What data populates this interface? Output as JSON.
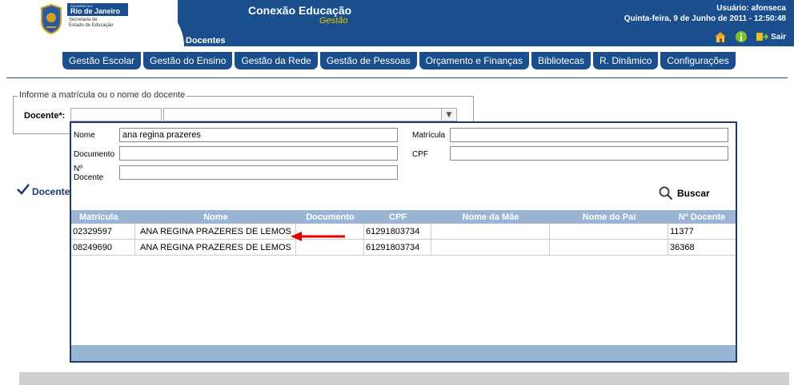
{
  "header": {
    "logo_gov": "GOVERNO DO",
    "logo_rio": "Rio de Janeiro",
    "logo_secretaria": "Secretaria de",
    "logo_estado": "Estado de Educação",
    "app_title": "Conexão Educação",
    "app_subtitle": "Gestão",
    "page_title": "Docentes",
    "user": "Usuário: afonseca",
    "date": "Quinta-feira, 9 de Junho de 2011 - 12:50:48",
    "sair": "Sair"
  },
  "nav": [
    "Gestão Escolar",
    "Gestão do Ensino",
    "Gestão da Rede",
    "Gestão de Pessoas",
    "Orçamento e Finanças",
    "Bibliotecas",
    "R. Dinâmico",
    "Configurações"
  ],
  "search_form": {
    "legend": "Informe a matrícula ou o nome do docente",
    "docente_label": "Docente*:",
    "dropdown_glyph": "▼"
  },
  "tab": {
    "label": "Docentes"
  },
  "popup": {
    "fields": {
      "nome_label": "Nome",
      "nome_value": "ana regina prazeres",
      "matricula_label": "Matrícula",
      "matricula_value": "",
      "documento_label": "Documento",
      "documento_value": "",
      "cpf_label": "CPF",
      "cpf_value": "",
      "ndocente_label_1": "Nº",
      "ndocente_label_2": "Docente",
      "ndocente_value": ""
    },
    "search_label": "Buscar",
    "columns": [
      "Matrícula",
      "Nome",
      "Documento",
      "CPF",
      "Nome da Mãe",
      "Nome do Pai",
      "Nº Docente"
    ],
    "rows": [
      [
        "02329597",
        "ANA REGINA PRAZERES DE LEMOS",
        "",
        "61291803734",
        "",
        "",
        "11377"
      ],
      [
        "08249690",
        "ANA REGINA PRAZERES DE LEMOS",
        "",
        "61291803734",
        "",
        "",
        "36368"
      ]
    ]
  },
  "colors": {
    "header_blue": "#1a4e8c",
    "table_header": "#9ab4d4",
    "popup_border": "#1e3a6e",
    "arrow_red": "#e00000"
  }
}
